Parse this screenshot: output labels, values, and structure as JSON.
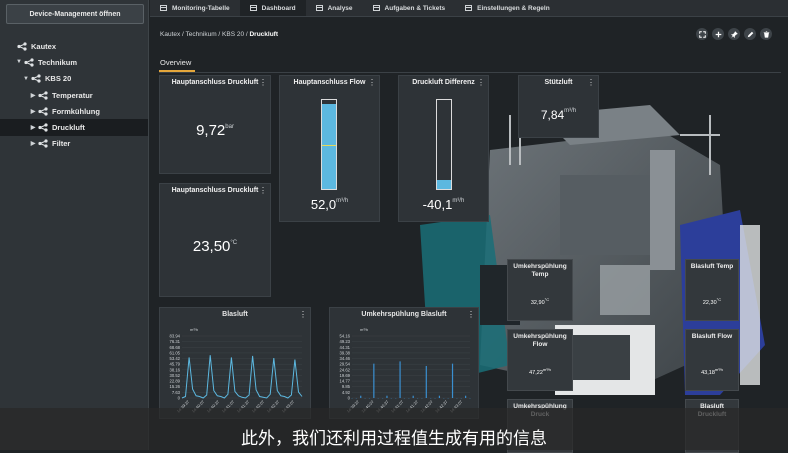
{
  "sidebar": {
    "device_button": "Device-Management öffnen",
    "tree": [
      {
        "label": "Kautex",
        "level": 0,
        "chevron": ""
      },
      {
        "label": "Technikum",
        "level": 1,
        "chevron": "▼"
      },
      {
        "label": "KBS 20",
        "level": 2,
        "chevron": "▼"
      },
      {
        "label": "Temperatur",
        "level": 3,
        "chevron": "▶"
      },
      {
        "label": "Formkühlung",
        "level": 3,
        "chevron": "▶"
      },
      {
        "label": "Druckluft",
        "level": 3,
        "chevron": "▶",
        "selected": true
      },
      {
        "label": "Filter",
        "level": 3,
        "chevron": "▶"
      }
    ]
  },
  "tabs": [
    {
      "label": "Monitoring-Tabelle",
      "active": false
    },
    {
      "label": "Dashboard",
      "active": true
    },
    {
      "label": "Analyse",
      "active": false
    },
    {
      "label": "Aufgaben & Tickets",
      "active": false
    },
    {
      "label": "Einstellungen & Regeln",
      "active": false
    }
  ],
  "breadcrumb": {
    "path": "Kautex / Technikum / KBS 20 / ",
    "current": "Druckluft"
  },
  "toolbar_icons": [
    "expand-icon",
    "plus-icon",
    "pin-icon",
    "edit-icon",
    "trash-icon"
  ],
  "overview_tab": "Overview",
  "cards": {
    "pressure1": {
      "title": "Hauptanschluss Druckluft",
      "value": "9,72",
      "unit": "bar"
    },
    "flow": {
      "title": "Hauptanschluss Flow",
      "value": "52,0",
      "unit": "m³/h",
      "fill": 0.95
    },
    "diff": {
      "title": "Druckluft Differenz",
      "value": "-40,1",
      "unit": "m³/h",
      "fill": 0.1
    },
    "stutz": {
      "title": "Stützluft",
      "value": "7,84",
      "unit": "m³/h"
    },
    "pressure2": {
      "title": "Hauptanschluss Druckluft",
      "value": "23,50",
      "unit": "°C"
    }
  },
  "machine_cards": [
    {
      "title": "Umkehrspühlung Temp",
      "value": "32,90",
      "unit": "°C"
    },
    {
      "title": "Umkehrspühlung Flow",
      "value": "47,22",
      "unit": "m³/h"
    },
    {
      "title": "Umkehrspühlung Druck",
      "value": "",
      "unit": ""
    },
    {
      "title": "Blasluft Temp",
      "value": "22,30",
      "unit": "°C"
    },
    {
      "title": "Blasluft Flow",
      "value": "43,18",
      "unit": "m³/h"
    },
    {
      "title": "Blasluft Druckluft",
      "value": "",
      "unit": ""
    }
  ],
  "chart_data": [
    {
      "type": "line",
      "title": "Blasluft",
      "ylabel": "m³/h",
      "ylim": [
        0,
        83.94
      ],
      "yticks": [
        "83.94",
        "76.31",
        "68.68",
        "61.05",
        "53.42",
        "45.79",
        "38.16",
        "30.52",
        "22.89",
        "15.26",
        "7.63",
        "0"
      ],
      "xticks": [
        "14:39:37",
        "14:40:07",
        "14:40:37",
        "14:41:07",
        "14:41:37",
        "14:42:07",
        "14:42:37",
        "14:43:07"
      ],
      "series": [
        {
          "values": [
            0,
            2,
            55,
            12,
            3,
            2,
            0,
            4,
            58,
            10,
            3,
            2,
            0,
            5,
            55,
            9,
            3,
            1,
            0,
            4,
            57,
            11,
            2,
            1,
            0,
            5,
            54,
            10,
            3,
            2,
            0,
            4,
            52,
            8,
            2
          ]
        }
      ],
      "color": "#5cb8e0"
    },
    {
      "type": "bar",
      "title": "Umkehrspühlung Blasluft",
      "ylabel": "m³/h",
      "ylim": [
        0,
        54.16
      ],
      "yticks": [
        "54.16",
        "49.23",
        "44.31",
        "39.38",
        "34.46",
        "29.54",
        "24.62",
        "19.69",
        "14.77",
        "9.85",
        "4.92",
        "0"
      ],
      "xticks": [
        "14:39:37",
        "14:40:07",
        "14:40:37",
        "14:41:07",
        "14:41:37",
        "14:42:07",
        "14:42:37",
        "14:43:07"
      ],
      "series": [
        {
          "values": [
            0,
            0,
            2,
            0,
            0,
            30,
            0,
            0,
            2,
            0,
            0,
            32,
            0,
            0,
            2,
            0,
            0,
            28,
            0,
            0,
            2,
            0,
            0,
            30,
            0,
            0,
            2,
            0
          ]
        }
      ],
      "color": "#3a8fd0"
    }
  ],
  "subtitle": "此外，我们还利用过程值生成有用的信息"
}
